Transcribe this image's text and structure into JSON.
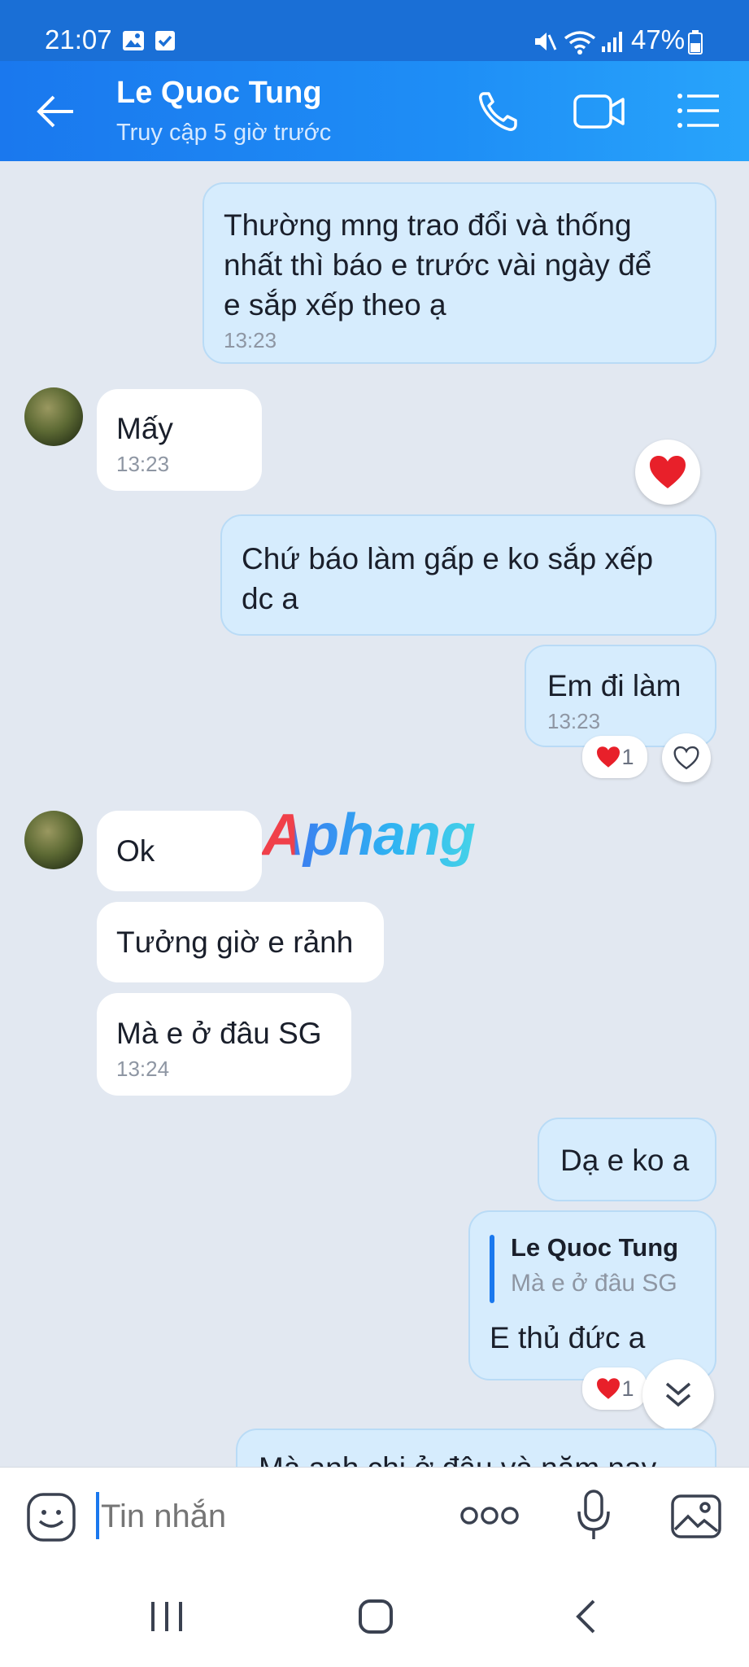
{
  "status_bar": {
    "time": "21:07",
    "battery": "47%"
  },
  "header": {
    "contact_name": "Le Quoc Tung",
    "last_seen": "Truy cập 5 giờ trước"
  },
  "messages": {
    "m1": {
      "text_l1": "Thường mng trao đổi và thống",
      "text_l2": "nhất thì báo e trước vài ngày để",
      "text_l3": "e sắp xếp theo ạ",
      "time": "13:23"
    },
    "m2": {
      "text": "Mấy",
      "time": "13:23"
    },
    "m3": {
      "text_l1": "Chứ báo làm gấp e ko sắp xếp",
      "text_l2": "dc a"
    },
    "m4": {
      "text": "Em đi làm",
      "time": "13:23",
      "reaction_count": "1"
    },
    "m5": {
      "text": "Ok"
    },
    "m6": {
      "text": "Tưởng giờ e rảnh"
    },
    "m7": {
      "text": "Mà e ở đâu SG",
      "time": "13:24"
    },
    "m8": {
      "text": "Dạ e ko a"
    },
    "m9": {
      "quote_author": "Le Quoc Tung",
      "quote_text": "Mà e ở đâu SG",
      "text": "E thủ đức a",
      "reaction_count": "1"
    },
    "m10": {
      "text_partial": "Mà anh chị ở đâu và năm nay"
    }
  },
  "watermark": {
    "text": "Aphang"
  },
  "input": {
    "placeholder": "Tin nhắn"
  },
  "colors": {
    "header": "#1a78ee",
    "outgoing_bubble": "#d6ecfd",
    "incoming_bubble": "#ffffff",
    "background": "#e2e8f1",
    "heart": "#e8202a"
  }
}
